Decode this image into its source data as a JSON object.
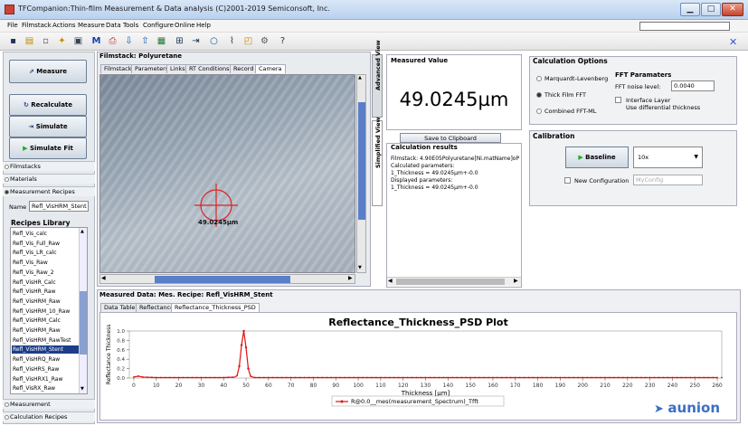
{
  "window": {
    "title": "TFCompanion:Thin-film Measurement & Data analysis (C)2001-2019 Semiconsoft, Inc.",
    "min_symbol": "▁",
    "max_symbol": "□",
    "close_symbol": "✕"
  },
  "menubar": [
    "File",
    "Filmstack",
    "Actions",
    "Measure",
    "Data",
    "Tools",
    "Configure",
    "Online",
    "Help"
  ],
  "toolbar": {
    "icons": [
      "save-icon",
      "open-folder-icon",
      "new-document-icon",
      "magic-wand-icon",
      "monitor-icon",
      "m-icon",
      "print-icon",
      "arrow-down-icon",
      "arrow-up-icon",
      "grid-icon",
      "calculator-icon",
      "simulate-icon",
      "circle-icon",
      "spectrum-icon",
      "chart-icon",
      "settings-icon",
      "help-icon"
    ],
    "glyphs": [
      "▪",
      "▤",
      "▫",
      "✦",
      "▣",
      "M",
      "⎙",
      "⇩",
      "⇧",
      "▦",
      "⊞",
      "⇥",
      "○",
      "⌇",
      "◰",
      "⚙",
      "?"
    ],
    "close_glyph": "✕"
  },
  "left": {
    "measure": "Measure",
    "recalculate": "Recalculate",
    "simulate": "Simulate",
    "simulate_fit": "Simulate Fit",
    "nav": [
      "Filmstacks",
      "Materials",
      "Measurement Recipes"
    ],
    "name_label": "Name",
    "name_value": "Refl_VisHRM_Stent",
    "recipes_title": "Recipes Library",
    "recipes": [
      "Refl_Vis_calc",
      "Refl_Vis_Full_Raw",
      "Refl_Vis_LR_calc",
      "Refl_Vis_Raw",
      "Refl_Vis_Raw_2",
      "Refl_VisHR_Calc",
      "Refl_VisHR_Raw",
      "Refl_VisHRM_Raw",
      "Refl_VisHRM_10_Raw",
      "Refl_VisHRM_Calc",
      "Refl_VisHRM_Raw",
      "Refl_VisHRM_RawTest",
      "Refl_VisHRM_Stent",
      "Refl_VisHRQ_Raw",
      "Refl_VisHRS_Raw",
      "Refl_VisHRX1_Raw",
      "Refl_VisRX_Raw"
    ],
    "selected_recipe_index": 12,
    "bottom_nav": [
      "Measurement",
      "Calculation Recipes"
    ]
  },
  "filmstack": {
    "title": "Filmstack: Polyuretane",
    "tabs": [
      "Filmstack",
      "Parameters",
      "Links",
      "RT Conditions",
      "Record",
      "Camera"
    ],
    "active_tab": 5,
    "crosshair_label": "49.0245µm"
  },
  "vertical_tabs": {
    "advanced": "Advanced View",
    "simplified": "Simplified View"
  },
  "measured": {
    "title": "Measured Value",
    "value": "49.0245µm",
    "clipboard": "Save to Clipboard"
  },
  "calc": {
    "title": "Calculation results",
    "text": "Filmstack: 4.90E05Polyuretane[Ni.matName]oP\nCalculated parameters:\n1_Thickness = 49.0245µm+-0.0\nDisplayed parameters:\n1_Thickness = 49.0245µm+-0.0"
  },
  "calc_options": {
    "title": "Calculation Options",
    "radios": [
      "Marquardt-Levenberg",
      "Thick Film FFT",
      "Combined FFT-ML"
    ],
    "selected": 1,
    "fft_title": "FFT Paramaters",
    "fft_noise_label": "FFT noise level:",
    "fft_noise_value": "0.0040",
    "interface_label_1": "Interface Layer",
    "interface_label_2": "Use differential thickness"
  },
  "calibration": {
    "title": "Calibration",
    "baseline": "Baseline",
    "magnification": "10x",
    "new_config": "New Configuration",
    "config_placeholder": "MyConfig"
  },
  "mdata": {
    "title": "Measured Data: Mes. Recipe: Refl_VisHRM_Stent",
    "tabs": [
      "Data Table",
      "Reflectance",
      "Reflectance_Thickness_PSD"
    ],
    "active_tab": 2
  },
  "chart_data": {
    "type": "line",
    "title": "Reflectance_Thickness_PSD Plot",
    "xlabel": "Thickness [µm]",
    "ylabel": "Reflectance Thickness",
    "xlim": [
      -2,
      262
    ],
    "ylim": [
      0,
      1.0
    ],
    "x_ticks": [
      0,
      10,
      20,
      30,
      40,
      50,
      60,
      70,
      80,
      90,
      100,
      110,
      120,
      130,
      140,
      150,
      160,
      170,
      180,
      190,
      200,
      210,
      220,
      230,
      240,
      250,
      260
    ],
    "y_ticks": [
      "0.0",
      "0.2",
      "0.4",
      "0.6",
      "0.8",
      "1.0"
    ],
    "series": [
      {
        "name": "R@0.0__mes(measurement_Spectrum)_Tfft",
        "color": "#e01010",
        "x": [
          0,
          1,
          2,
          3,
          4,
          10,
          20,
          30,
          40,
          45,
          46,
          47,
          48,
          49,
          50,
          51,
          52,
          53,
          54,
          60,
          80,
          100,
          150,
          200,
          250,
          260
        ],
        "y": [
          0.02,
          0.03,
          0.04,
          0.03,
          0.02,
          0.01,
          0.01,
          0.01,
          0.01,
          0.02,
          0.05,
          0.25,
          0.7,
          1.0,
          0.65,
          0.2,
          0.04,
          0.02,
          0.01,
          0.01,
          0.01,
          0.01,
          0.01,
          0.01,
          0.01,
          0.01
        ]
      }
    ]
  },
  "watermark": "aunion"
}
